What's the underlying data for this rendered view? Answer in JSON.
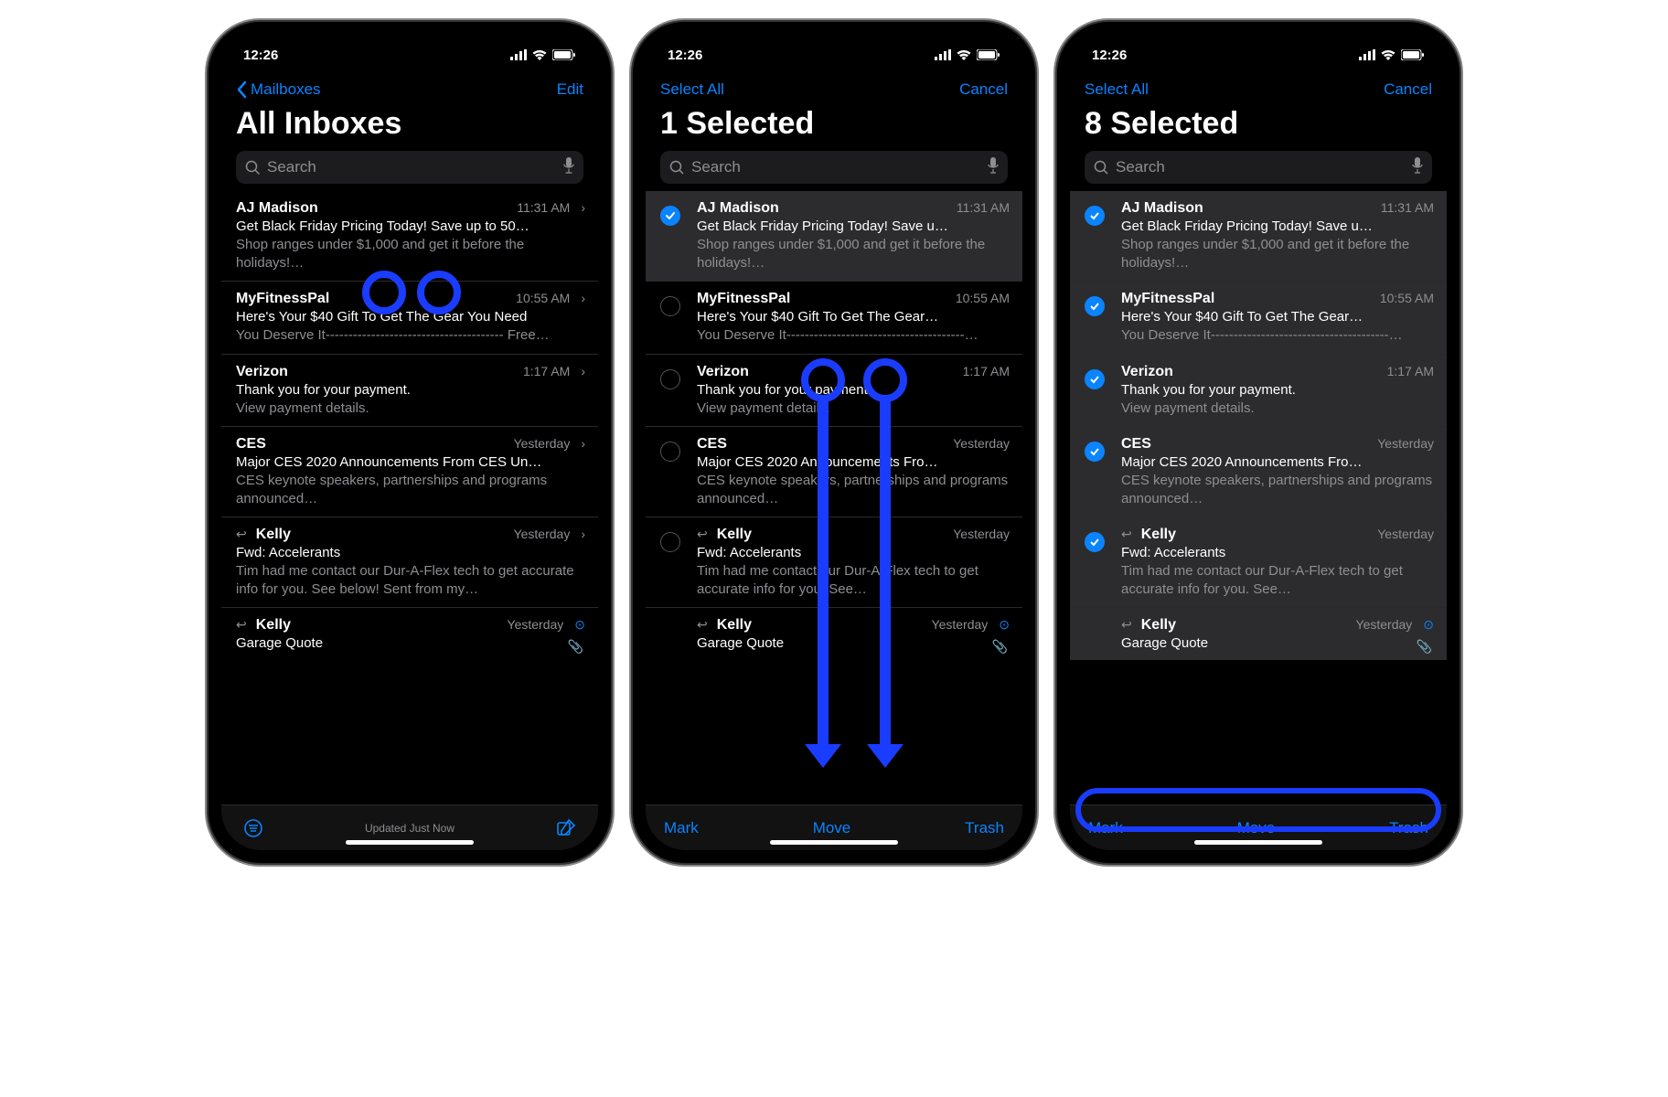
{
  "status": {
    "time": "12:26"
  },
  "nav": {
    "back_label": "Mailboxes",
    "edit_label": "Edit",
    "select_all_label": "Select All",
    "cancel_label": "Cancel"
  },
  "titles": {
    "all_inboxes": "All Inboxes",
    "one_selected": "1 Selected",
    "eight_selected": "8 Selected"
  },
  "search": {
    "placeholder": "Search"
  },
  "toolbar": {
    "updated_text": "Updated Just Now",
    "mark": "Mark",
    "move": "Move",
    "trash": "Trash"
  },
  "emails": [
    {
      "sender": "AJ Madison",
      "time": "11:31 AM",
      "subject_full": "Get Black Friday Pricing Today! Save up to 50…",
      "subject_trunc": "Get Black Friday Pricing Today! Save u…",
      "preview_full": "Shop ranges under $1,000 and get it before the holidays!…",
      "preview_trunc": "Shop ranges under $1,000 and get it before the holidays!…"
    },
    {
      "sender": "MyFitnessPal",
      "time": "10:55 AM",
      "subject_full": "Here's Your $40 Gift To Get The Gear You Need",
      "subject_trunc": "Here's Your $40 Gift To Get The Gear…",
      "preview_full": "You Deserve It--------------------------------------- Free…",
      "preview_trunc": "You Deserve It---------------------------------------…"
    },
    {
      "sender": "Verizon",
      "time": "1:17 AM",
      "subject_full": "Thank you for your payment.",
      "subject_trunc": "Thank you for your payment.",
      "preview_full": "View payment details.",
      "preview_trunc": "View payment details."
    },
    {
      "sender": "CES",
      "time": "Yesterday",
      "subject_full": "Major CES 2020 Announcements From CES Un…",
      "subject_trunc": "Major CES 2020 Announcements Fro…",
      "preview_full": "CES keynote speakers, partnerships and programs announced…",
      "preview_trunc": "CES keynote speakers, partnerships and programs announced…"
    },
    {
      "sender": "Kelly",
      "time": "Yesterday",
      "subject_full": "Fwd: Accelerants",
      "subject_trunc": "Fwd: Accelerants",
      "preview_full": "Tim had me contact our Dur-A-Flex tech to get accurate info for you. See below! Sent from my…",
      "preview_trunc": "Tim had me contact our Dur-A-Flex tech to get accurate info for you. See…",
      "replied": true
    },
    {
      "sender": "Kelly",
      "time": "Yesterday",
      "subject_full": "Garage Quote",
      "subject_trunc": "Garage Quote",
      "preview_full": "",
      "preview_trunc": "",
      "replied": true,
      "attachment": true,
      "blue_disclosure": true
    }
  ]
}
